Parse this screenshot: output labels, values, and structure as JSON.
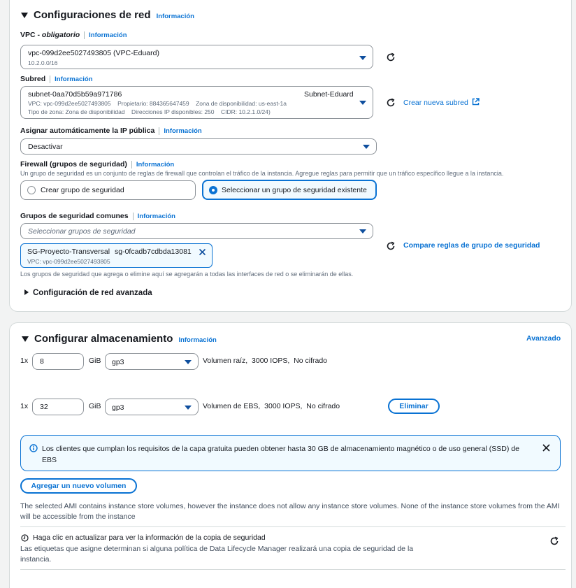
{
  "network": {
    "title": "Configuraciones de red",
    "info": "Información",
    "vpc": {
      "label_main": "VPC - ",
      "label_em": "obligatorio",
      "info": "Información",
      "value": "vpc-099d2ee5027493805 (VPC-Eduard)",
      "cidr": "10.2.0.0/16"
    },
    "subnet": {
      "label": "Subred",
      "info": "Información",
      "value": "subnet-0aa70d5b59a971786",
      "name": "Subnet-Eduard",
      "line2": "VPC: vpc-099d2ee5027493805    Propietario: 884365647459    Zona de disponibilidad: us-east-1a",
      "line3": "Tipo de zona: Zona de disponibilidad    Direcciones IP disponibles: 250    CIDR: 10.2.1.0/24)",
      "create_link": "Crear nueva subred"
    },
    "public_ip": {
      "label": "Asignar automáticamente la IP pública",
      "info": "Información",
      "value": "Desactivar"
    },
    "firewall": {
      "label": "Firewall (grupos de seguridad)",
      "info": "Información",
      "description": "Un grupo de seguridad es un conjunto de reglas de firewall que controlan el tráfico de la instancia. Agregue reglas para permitir que un tráfico específico llegue a la instancia.",
      "option_create": "Crear grupo de seguridad",
      "option_select": "Seleccionar un grupo de seguridad existente",
      "selected": "option_select"
    },
    "common_groups": {
      "label": "Grupos de seguridad comunes",
      "info": "Información",
      "placeholder": "Seleccionar grupos de seguridad",
      "token_name": "SG-Proyecto-Transversal",
      "token_id": "sg-0fcadb7cdbda13081",
      "token_vpc": "VPC: vpc-099d2ee5027493805",
      "compare_link": "Compare reglas de grupo de seguridad",
      "note": "Los grupos de seguridad que agrega o elimine aquí se agregarán a todas las interfaces de red o se eliminarán de ellas."
    },
    "advanced": "Configuración de red avanzada"
  },
  "storage": {
    "title": "Configurar almacenamiento",
    "info": "Información",
    "advanced_link": "Avanzado",
    "volumes": [
      {
        "mult": "1x",
        "size": "8",
        "unit": "GiB",
        "type": "gp3",
        "desc": "Volumen raíz,  3000 IOPS,  No cifrado"
      },
      {
        "mult": "1x",
        "size": "32",
        "unit": "GiB",
        "type": "gp3",
        "desc": "Volumen de EBS,  3000 IOPS,  No cifrado",
        "remove": "Eliminar"
      }
    ],
    "alert": "Los clientes que cumplan los requisitos de la capa gratuita pueden obtener hasta 30 GB de almacenamiento magnético o de uso general (SSD) de EBS",
    "add_volume": "Agregar un nuevo volumen",
    "instance_store_note": "The selected AMI contains instance store volumes, however the instance does not allow any instance store volumes. None of the instance store volumes from the AMI will be accessible from the instance",
    "backup_title": "Haga clic en actualizar para ver la información de la copia de seguridad",
    "backup_desc": "Las etiquetas que asigne determinan si alguna política de Data Lifecycle Manager realizará una copia de seguridad de la instancia."
  },
  "colors": {
    "accent": "#0972d3",
    "border": "#8d9399",
    "text": "#16191f",
    "muted": "#5f6b7a",
    "alert_bg": "#f1faff"
  },
  "icons": [
    "caret-down-icon",
    "caret-right-icon",
    "refresh-icon",
    "external-link-icon",
    "close-icon",
    "info-circle-icon",
    "clock-icon"
  ]
}
